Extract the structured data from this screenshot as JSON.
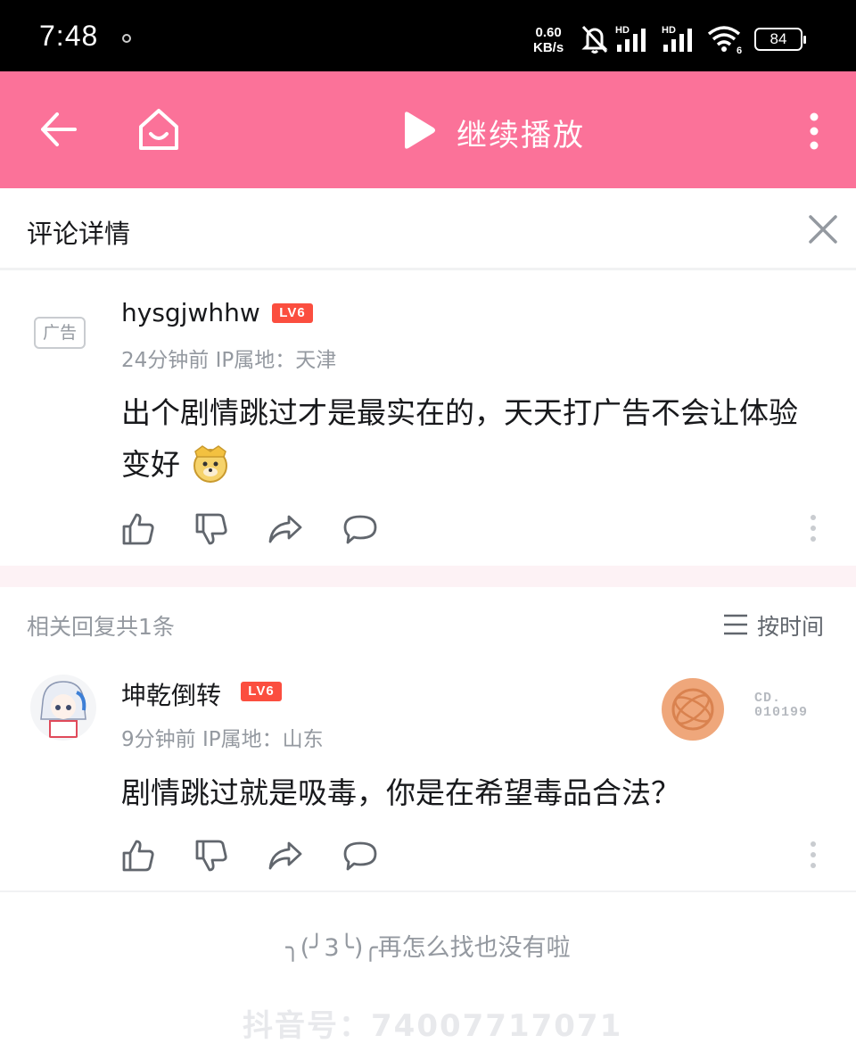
{
  "status_bar": {
    "time": "7:48",
    "net_speed_value": "0.60",
    "net_speed_unit": "KB/s",
    "signal_label_1": "HD",
    "signal_label_2": "HD",
    "wifi_label": "6",
    "battery": "84"
  },
  "top_bar": {
    "title": "继续播放",
    "background_color": "#fb7299"
  },
  "detail": {
    "title": "评论详情"
  },
  "main_comment": {
    "ad_badge": "广告",
    "username": "hysgjwhhw",
    "level": "LV6",
    "meta": "24分钟前 IP属地：天津",
    "content": "出个剧情跳过才是最实在的，天天打广告不会让体验变好"
  },
  "replies": {
    "header": "相关回复共1条",
    "sort_label": "按时间",
    "items": [
      {
        "username": "坤乾倒转",
        "level": "LV6",
        "meta": "9分钟前 IP属地：山东",
        "content": "剧情跳过就是吸毒，你是在希望毒品合法？",
        "fan_label": "CD.",
        "fan_number": "010199"
      }
    ]
  },
  "footer": {
    "end_text": "╮(╯3╰)╭再怎么找也没有啦",
    "watermark": "抖音号：74007717071"
  },
  "colors": {
    "accent": "#fb7299",
    "level_badge": "#fb4e3f",
    "meta_text": "#9499a0"
  }
}
